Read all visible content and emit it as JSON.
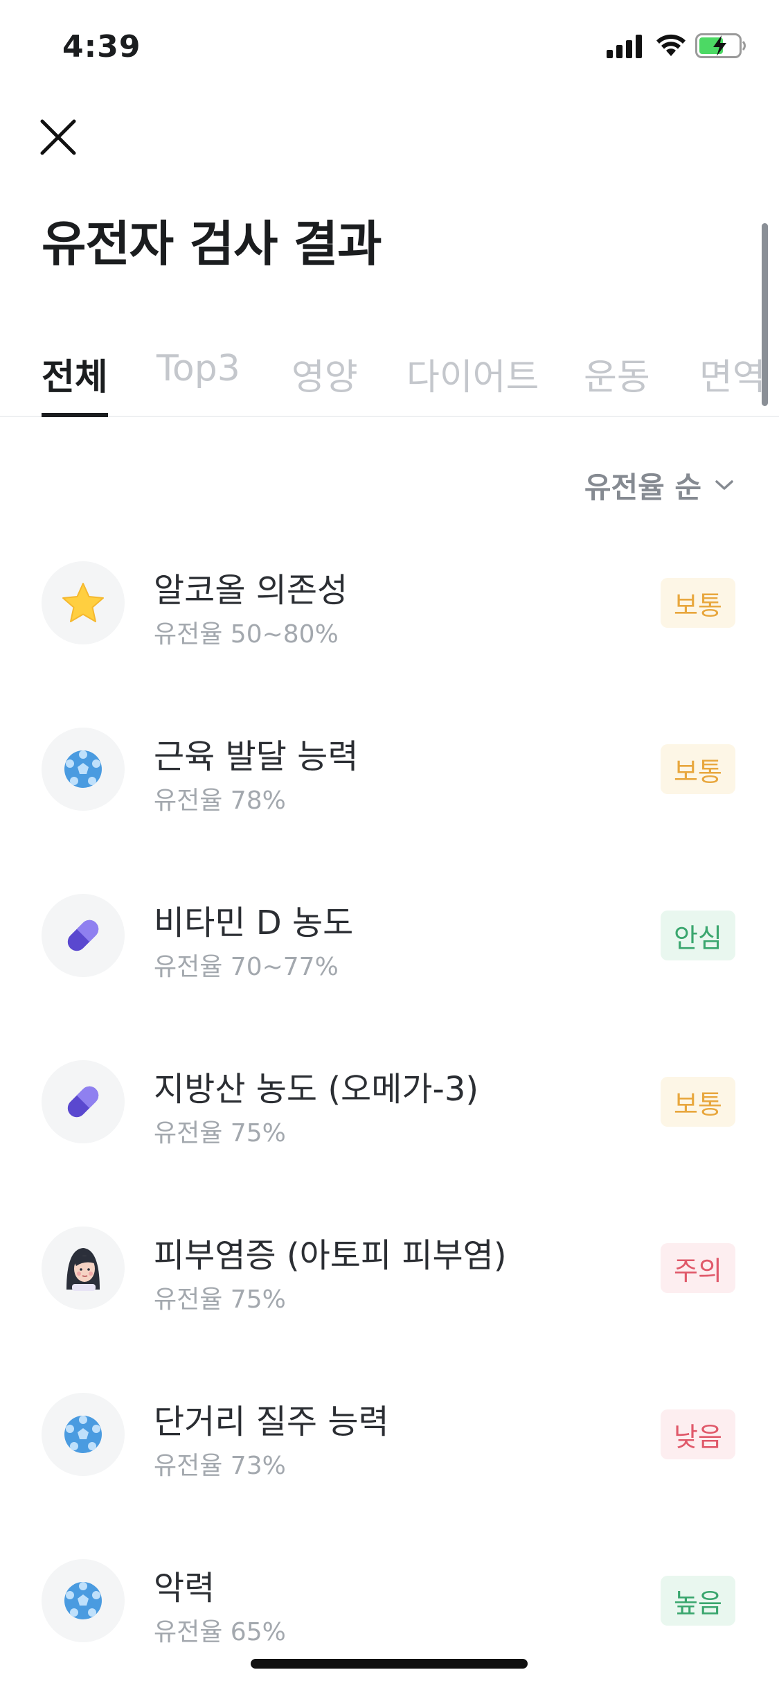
{
  "status_bar": {
    "time": "4:39",
    "icons": [
      "signal-icon",
      "wifi-icon",
      "battery-charging-icon"
    ]
  },
  "header": {
    "close_icon": "close-icon",
    "title": "유전자 검사 결과"
  },
  "tabs": [
    {
      "label": "전체",
      "active": true
    },
    {
      "label": "Top3",
      "active": false
    },
    {
      "label": "영양",
      "active": false
    },
    {
      "label": "다이어트",
      "active": false
    },
    {
      "label": "운동",
      "active": false
    },
    {
      "label": "면역",
      "active": false
    }
  ],
  "sort": {
    "label": "유전율 순",
    "icon": "chevron-down-icon"
  },
  "results": [
    {
      "icon": "star-icon",
      "name": "알코올 의존성",
      "heritability": "유전율 50~80%",
      "badge": "보통"
    },
    {
      "icon": "ball-icon",
      "name": "근육 발달 능력",
      "heritability": "유전율 78%",
      "badge": "보통"
    },
    {
      "icon": "pill-icon",
      "name": "비타민 D 농도",
      "heritability": "유전율 70~77%",
      "badge": "안심"
    },
    {
      "icon": "pill-icon",
      "name": "지방산 농도 (오메가-3)",
      "heritability": "유전율 75%",
      "badge": "보통"
    },
    {
      "icon": "face-icon",
      "name": "피부염증 (아토피 피부염)",
      "heritability": "유전율 75%",
      "badge": "주의"
    },
    {
      "icon": "ball-icon",
      "name": "단거리 질주 능력",
      "heritability": "유전율 73%",
      "badge": "낮음"
    },
    {
      "icon": "ball-icon",
      "name": "악력",
      "heritability": "유전율 65%",
      "badge": "높음"
    }
  ],
  "badge_colors": {
    "보통": {
      "text": "#e8a73e",
      "bg": "#fdf6e6"
    },
    "안심": {
      "text": "#3aa66e",
      "bg": "#e9f7ef"
    },
    "주의": {
      "text": "#e0596a",
      "bg": "#fdeef0"
    },
    "낮음": {
      "text": "#e0596a",
      "bg": "#fdeef0"
    },
    "높음": {
      "text": "#3aa66e",
      "bg": "#e9f7ef"
    }
  }
}
